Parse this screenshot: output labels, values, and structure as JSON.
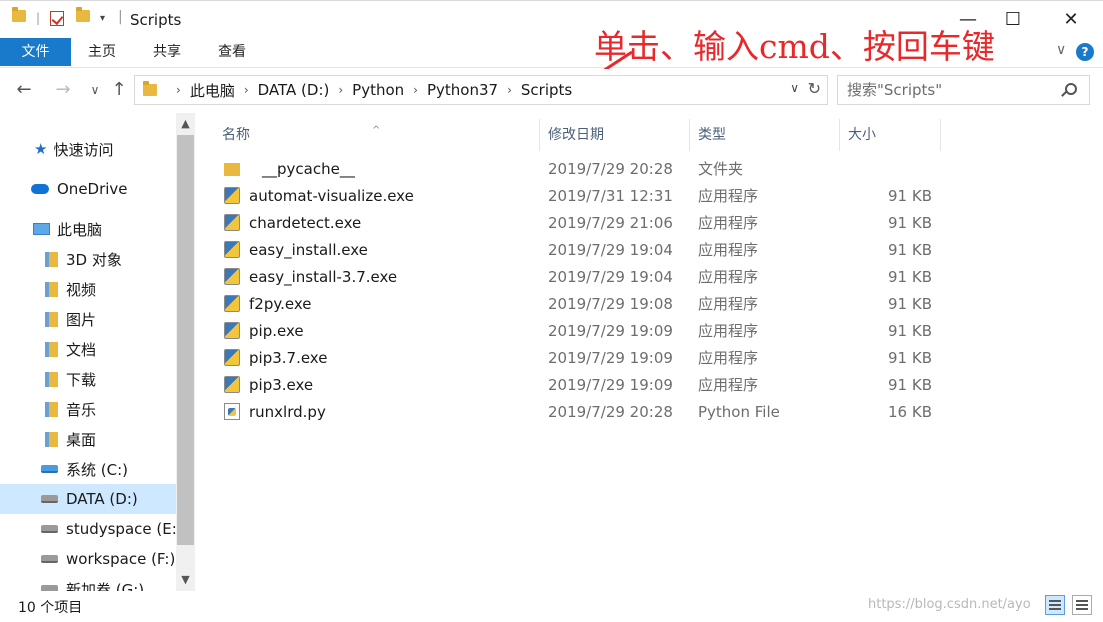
{
  "window": {
    "title": "Scripts",
    "minimize": "—",
    "maximize": "☐",
    "close": "✕"
  },
  "ribbon": {
    "tabs": [
      "文件",
      "主页",
      "共享",
      "查看"
    ],
    "chevron": "∨",
    "help": "?"
  },
  "annotation": {
    "text": "单击、输入cmd、按回车键",
    "color": "#e8282a"
  },
  "address": {
    "crumbs": [
      "此电脑",
      "DATA (D:)",
      "Python",
      "Python37",
      "Scripts"
    ],
    "search_placeholder": "搜索\"Scripts\""
  },
  "navigation": {
    "back": "←",
    "forward": "→",
    "recent": "∨",
    "up": "↑",
    "refresh": "↻",
    "dropdown": "∨"
  },
  "sidebar": {
    "items": [
      {
        "label": "快速访问",
        "icon": "star-icon"
      },
      {
        "label": "OneDrive",
        "icon": "cloud-icon"
      },
      {
        "label": "此电脑",
        "icon": "computer-icon"
      },
      {
        "label": "3D 对象",
        "icon": "3d-objects-icon"
      },
      {
        "label": "视频",
        "icon": "videos-icon"
      },
      {
        "label": "图片",
        "icon": "pictures-icon"
      },
      {
        "label": "文档",
        "icon": "documents-icon"
      },
      {
        "label": "下载",
        "icon": "downloads-icon"
      },
      {
        "label": "音乐",
        "icon": "music-icon"
      },
      {
        "label": "桌面",
        "icon": "desktop-icon"
      },
      {
        "label": "系统 (C:)",
        "icon": "system-drive-icon"
      },
      {
        "label": "DATA (D:)",
        "icon": "drive-icon",
        "selected": true
      },
      {
        "label": "studyspace (E:)",
        "icon": "drive-icon"
      },
      {
        "label": "workspace (F:)",
        "icon": "drive-icon"
      },
      {
        "label": "新加卷 (G:)",
        "icon": "drive-icon"
      }
    ]
  },
  "columns": {
    "name": "名称",
    "date": "修改日期",
    "type": "类型",
    "size": "大小"
  },
  "files": [
    {
      "name": "__pycache__",
      "date": "2019/7/29 20:28",
      "type": "文件夹",
      "size": "",
      "icon": "folder-icon"
    },
    {
      "name": "automat-visualize.exe",
      "date": "2019/7/31 12:31",
      "type": "应用程序",
      "size": "91 KB",
      "icon": "python-exe-icon"
    },
    {
      "name": "chardetect.exe",
      "date": "2019/7/29 21:06",
      "type": "应用程序",
      "size": "91 KB",
      "icon": "python-exe-icon"
    },
    {
      "name": "easy_install.exe",
      "date": "2019/7/29 19:04",
      "type": "应用程序",
      "size": "91 KB",
      "icon": "python-exe-icon"
    },
    {
      "name": "easy_install-3.7.exe",
      "date": "2019/7/29 19:04",
      "type": "应用程序",
      "size": "91 KB",
      "icon": "python-exe-icon"
    },
    {
      "name": "f2py.exe",
      "date": "2019/7/29 19:08",
      "type": "应用程序",
      "size": "91 KB",
      "icon": "python-exe-icon"
    },
    {
      "name": "pip.exe",
      "date": "2019/7/29 19:09",
      "type": "应用程序",
      "size": "91 KB",
      "icon": "python-exe-icon"
    },
    {
      "name": "pip3.7.exe",
      "date": "2019/7/29 19:09",
      "type": "应用程序",
      "size": "91 KB",
      "icon": "python-exe-icon"
    },
    {
      "name": "pip3.exe",
      "date": "2019/7/29 19:09",
      "type": "应用程序",
      "size": "91 KB",
      "icon": "python-exe-icon"
    },
    {
      "name": "runxlrd.py",
      "date": "2019/7/29 20:28",
      "type": "Python File",
      "size": "16 KB",
      "icon": "python-file-icon"
    }
  ],
  "status": {
    "count": "10 个项目",
    "watermark": "https://blog.csdn.net/ayo"
  },
  "colors": {
    "accent": "#1979ca",
    "selection": "#cde8ff"
  }
}
